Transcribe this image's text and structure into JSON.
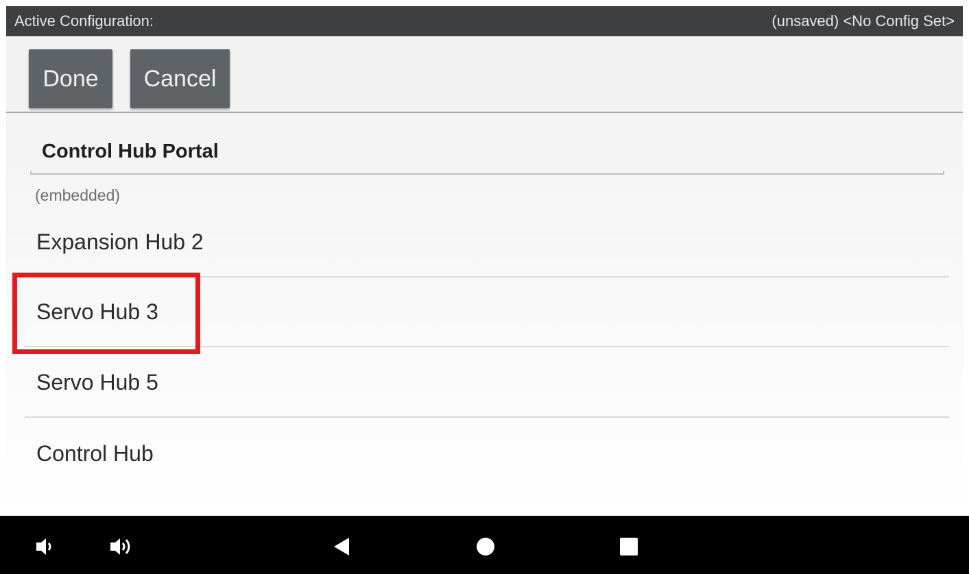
{
  "topbar": {
    "label": "Active Configuration:",
    "status": "(unsaved) <No Config Set>"
  },
  "toolbar": {
    "done_label": "Done",
    "cancel_label": "Cancel"
  },
  "portal": {
    "title": "Control Hub Portal",
    "subtitle": "(embedded)"
  },
  "devices": [
    {
      "label": "Expansion Hub 2"
    },
    {
      "label": "Servo Hub 3",
      "highlighted": true
    },
    {
      "label": "Servo Hub 5"
    },
    {
      "label": "Control Hub"
    }
  ],
  "navbar": {
    "icons": [
      "volume-down-icon",
      "volume-up-icon",
      "back-icon",
      "home-icon",
      "recents-icon"
    ]
  },
  "colors": {
    "highlight": "#e41b1b",
    "button_bg": "#5e6367",
    "topbar_bg": "#3d3f41"
  }
}
